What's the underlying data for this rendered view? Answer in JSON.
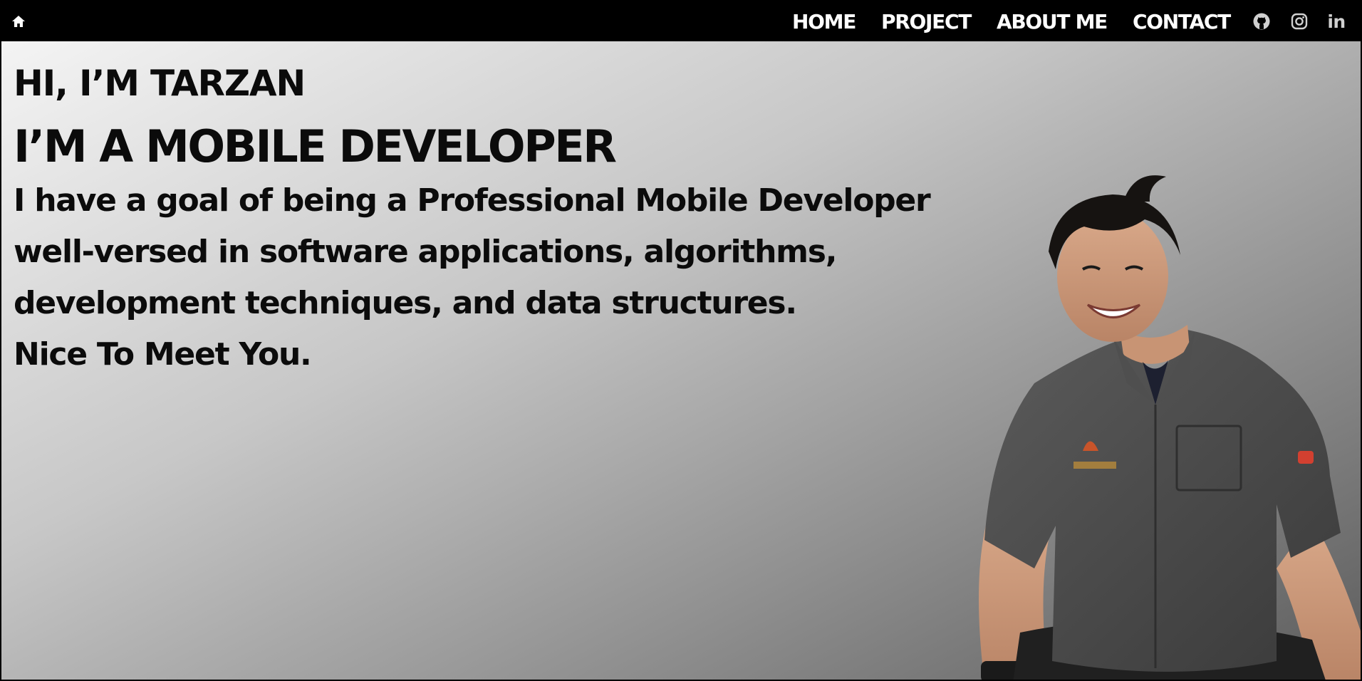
{
  "nav": {
    "home_icon": "home-icon",
    "links": [
      "HOME",
      "PROJECT",
      "ABOUT ME",
      "CONTACT"
    ],
    "social_icons": [
      "github-icon",
      "instagram-icon",
      "linkedin-icon"
    ],
    "linkedin_text": "in"
  },
  "hero": {
    "greeting": "HI, I’M TARZAN",
    "role": "I’M A MOBILE DEVELOPER",
    "bio_lines": [
      "I have a goal of being a Professional Mobile Developer",
      "well-versed in software applications, algorithms,",
      "development techniques, and data structures.",
      "Nice To Meet You."
    ]
  },
  "colors": {
    "navbar_bg": "#000000",
    "nav_text": "#ffffff",
    "hero_text": "#0b0b0b",
    "gradient_start": "#f4f4f4",
    "gradient_end": "#5c5c5c",
    "shirt": "#4a4a4a",
    "badge": "#c8542a"
  }
}
